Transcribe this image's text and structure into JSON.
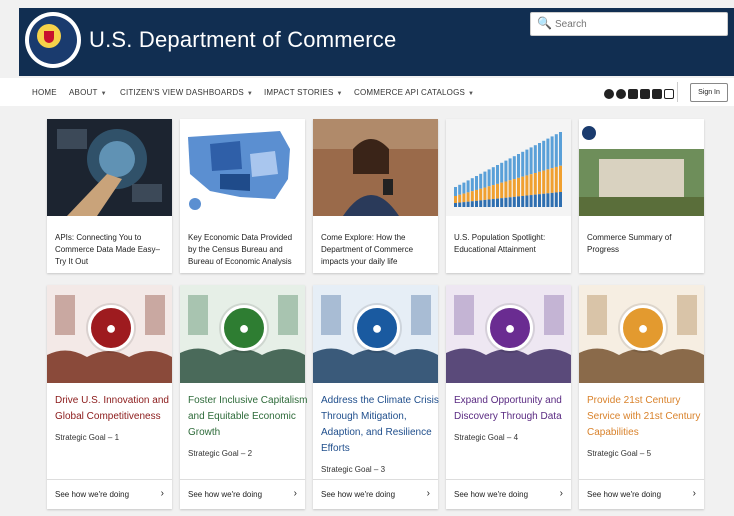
{
  "header": {
    "title": "U.S. Department of Commerce",
    "seal_label": "DEPARTMENT OF COMMERCE",
    "search_placeholder": "Search"
  },
  "nav": {
    "items": [
      {
        "label": "HOME"
      },
      {
        "label": "ABOUT",
        "has_dropdown": true
      },
      {
        "label": "CITIZEN'S VIEW DASHBOARDS",
        "has_dropdown": true
      },
      {
        "label": "IMPACT STORIES",
        "has_dropdown": true
      },
      {
        "label": "COMMERCE API CATALOGS",
        "has_dropdown": true
      }
    ],
    "social_icons": [
      "github-icon",
      "flickr-icon",
      "twitter-icon",
      "youtube-icon",
      "linkedin-icon",
      "instagram-icon"
    ],
    "sign_in": "Sign In"
  },
  "features": [
    {
      "text": "APIs: Connecting You to Commerce Data Made Easy–Try It Out"
    },
    {
      "text": "Key Economic Data Provided by the Census Bureau and Bureau of Economic Analysis"
    },
    {
      "text": "Come Explore: How the Department of Commerce impacts your daily life"
    },
    {
      "text": "U.S. Population Spotlight: Educational Attainment"
    },
    {
      "text": "Commerce Summary of Progress"
    }
  ],
  "goals": [
    {
      "title": "Drive U.S. Innovation and Global Competitiveness",
      "goal": "Strategic Goal – 1",
      "link": "See how we're doing",
      "color": "#8b1a1a",
      "medal": "#9e1b1f"
    },
    {
      "title": "Foster Inclusive Capitalism and Equitable Economic Growth",
      "goal": "Strategic Goal – 2",
      "link": "See how we're doing",
      "color": "#2e6b3a",
      "medal": "#2e7d32"
    },
    {
      "title": "Address the Climate Crisis Through Mitigation, Adaption, and Resilience Efforts",
      "goal": "Strategic Goal – 3",
      "link": "See how we're doing",
      "color": "#1f4e8c",
      "medal": "#1a5aa0"
    },
    {
      "title": "Expand Opportunity and Discovery Through Data",
      "goal": "Strategic Goal – 4",
      "link": "See how we're doing",
      "color": "#5a2a82",
      "medal": "#6a2c91"
    },
    {
      "title": "Provide 21st Century Service with 21st Century Capabilities",
      "goal": "Strategic Goal – 5",
      "link": "See how we're doing",
      "color": "#d9822b",
      "medal": "#e39a2f"
    }
  ]
}
